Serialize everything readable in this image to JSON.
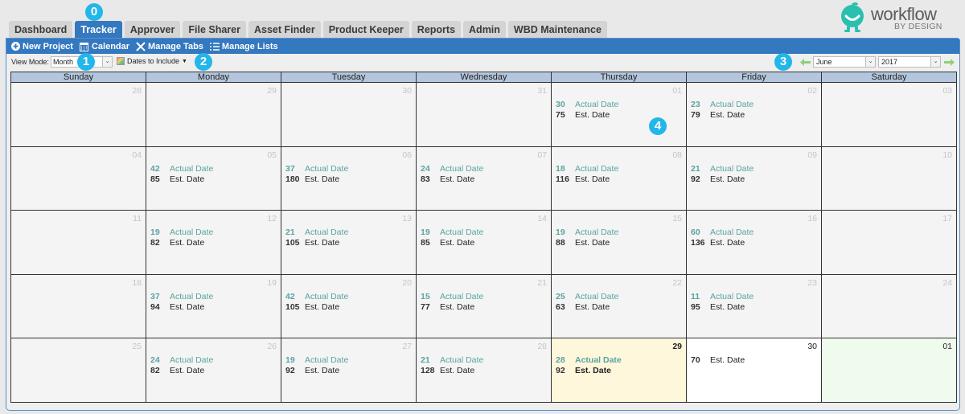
{
  "tabs": [
    {
      "label": "Dashboard",
      "active": false
    },
    {
      "label": "Tracker",
      "active": true
    },
    {
      "label": "Approver",
      "active": false
    },
    {
      "label": "File Sharer",
      "active": false
    },
    {
      "label": "Asset Finder",
      "active": false
    },
    {
      "label": "Product Keeper",
      "active": false
    },
    {
      "label": "Reports",
      "active": false
    },
    {
      "label": "Admin",
      "active": false
    },
    {
      "label": "WBD Maintenance",
      "active": false
    }
  ],
  "logo": {
    "word": "workflow",
    "sub": "BY DESIGN",
    "color": "#2bbfae"
  },
  "toolbar": {
    "new_project": "New Project",
    "calendar": "Calendar",
    "manage_tabs": "Manage Tabs",
    "manage_lists": "Manage Lists"
  },
  "subbar": {
    "view_mode_label": "View Mode:",
    "view_mode_value": "Month",
    "dates_to_include": "Dates to Include",
    "month_value": "June",
    "year_value": "2017"
  },
  "badges": [
    "0",
    "1",
    "2",
    "3",
    "4"
  ],
  "calendar": {
    "weekdays": [
      "Sunday",
      "Monday",
      "Tuesday",
      "Wednesday",
      "Thursday",
      "Friday",
      "Saturday"
    ],
    "actual_label": "Actual Date",
    "est_label": "Est. Date",
    "weeks": [
      [
        {
          "day": "28",
          "other": true
        },
        {
          "day": "29",
          "other": true
        },
        {
          "day": "30",
          "other": true
        },
        {
          "day": "31",
          "other": true
        },
        {
          "day": "01",
          "other": true,
          "actual": "30",
          "est": "75"
        },
        {
          "day": "02",
          "other": true,
          "actual": "23",
          "est": "79"
        },
        {
          "day": "03",
          "other": true
        }
      ],
      [
        {
          "day": "04",
          "other": true
        },
        {
          "day": "05",
          "other": true,
          "actual": "42",
          "est": "85"
        },
        {
          "day": "06",
          "other": true,
          "actual": "37",
          "est": "180"
        },
        {
          "day": "07",
          "other": true,
          "actual": "24",
          "est": "83"
        },
        {
          "day": "08",
          "other": true,
          "actual": "18",
          "est": "116"
        },
        {
          "day": "09",
          "other": true,
          "actual": "21",
          "est": "92"
        },
        {
          "day": "10",
          "other": true
        }
      ],
      [
        {
          "day": "11",
          "other": true
        },
        {
          "day": "12",
          "other": true,
          "actual": "19",
          "est": "82"
        },
        {
          "day": "13",
          "other": true,
          "actual": "21",
          "est": "105"
        },
        {
          "day": "14",
          "other": true,
          "actual": "19",
          "est": "85"
        },
        {
          "day": "15",
          "other": true,
          "actual": "19",
          "est": "88"
        },
        {
          "day": "16",
          "other": true,
          "actual": "60",
          "est": "136"
        },
        {
          "day": "17",
          "other": true
        }
      ],
      [
        {
          "day": "18",
          "other": true
        },
        {
          "day": "19",
          "other": true,
          "actual": "37",
          "est": "94"
        },
        {
          "day": "20",
          "other": true,
          "actual": "42",
          "est": "105"
        },
        {
          "day": "21",
          "other": true,
          "actual": "15",
          "est": "77"
        },
        {
          "day": "22",
          "other": true,
          "actual": "25",
          "est": "63"
        },
        {
          "day": "23",
          "other": true,
          "actual": "11",
          "est": "95"
        },
        {
          "day": "24",
          "other": true
        }
      ],
      [
        {
          "day": "25",
          "other": true
        },
        {
          "day": "26",
          "other": true,
          "actual": "24",
          "est": "82"
        },
        {
          "day": "27",
          "other": true,
          "actual": "19",
          "est": "92"
        },
        {
          "day": "28",
          "other": true,
          "actual": "21",
          "est": "128"
        },
        {
          "day": "29",
          "today": true,
          "actual": "28",
          "est": "92"
        },
        {
          "day": "30",
          "future": "white",
          "est": "70"
        },
        {
          "day": "01",
          "future": "green"
        }
      ]
    ]
  }
}
